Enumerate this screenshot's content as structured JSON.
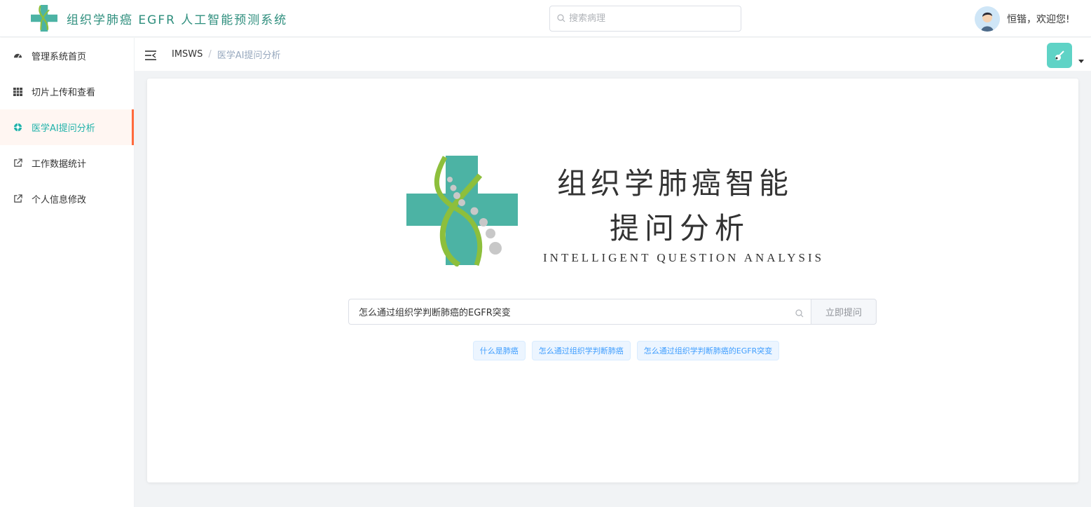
{
  "header": {
    "app_title": "组织学肺癌 EGFR 人工智能预测系统",
    "search_placeholder": "搜索病理",
    "welcome": "恒锴，欢迎您!"
  },
  "sidebar": {
    "items": [
      {
        "label": "管理系统首页",
        "icon": "dashboard-icon",
        "active": false
      },
      {
        "label": "切片上传和查看",
        "icon": "grid-table-icon",
        "active": false
      },
      {
        "label": "医学AI提问分析",
        "icon": "ai-circle-icon",
        "active": true
      },
      {
        "label": "工作数据统计",
        "icon": "external-link-icon",
        "active": false
      },
      {
        "label": "个人信息修改",
        "icon": "external-link-icon",
        "active": false
      }
    ]
  },
  "breadcrumb": {
    "root": "IMSWS",
    "separator": "/",
    "current": "医学AI提问分析"
  },
  "hero": {
    "title_line1": "组织学肺癌智能",
    "title_line2": "提问分析",
    "subtitle": "INTELLIGENT QUESTION ANALYSIS"
  },
  "ask": {
    "value": "怎么通过组织学判断肺癌的EGFR突变",
    "button": "立即提问"
  },
  "suggestions": [
    "什么是肺癌",
    "怎么通过组织学判断肺癌",
    "怎么通过组织学判断肺癌的EGFR突变"
  ],
  "colors": {
    "brand_teal": "#4cb3a4",
    "dna_green": "#8dbf3c",
    "active_text": "#20b2aa",
    "active_bar": "#ff6a3d",
    "tag_blue": "#409eff"
  }
}
